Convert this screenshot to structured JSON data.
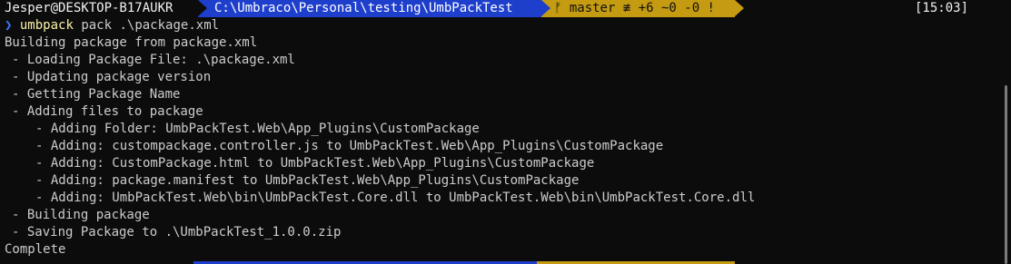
{
  "prompt": {
    "user_host": "Jesper@DESKTOP-B17AUKR",
    "path": "C:\\Umbraco\\Personal\\testing\\UmbPackTest",
    "git_icon": "",
    "git_status": "master ≢ +6 ~0 -0 !",
    "time": "[15:03]",
    "colors": {
      "path_bg": "#1e3fcc",
      "git_bg": "#c59b12",
      "chevron": "#3b78ff",
      "command": "#f9f1a5"
    }
  },
  "command": {
    "chevron": "❯",
    "name": "umbpack",
    "args": "pack .\\package.xml"
  },
  "output": [
    {
      "text": "Building package from package.xml",
      "level": 0
    },
    {
      "text": "- Loading Package File: .\\package.xml",
      "level": 1
    },
    {
      "text": "- Updating package version",
      "level": 1
    },
    {
      "text": "- Getting Package Name",
      "level": 1
    },
    {
      "text": "- Adding files to package",
      "level": 1
    },
    {
      "text": "- Adding Folder: UmbPackTest.Web\\App_Plugins\\CustomPackage",
      "level": 2
    },
    {
      "text": "- Adding: custompackage.controller.js to UmbPackTest.Web\\App_Plugins\\CustomPackage",
      "level": 2
    },
    {
      "text": "- Adding: CustomPackage.html to UmbPackTest.Web\\App_Plugins\\CustomPackage",
      "level": 2
    },
    {
      "text": "- Adding: package.manifest to UmbPackTest.Web\\App_Plugins\\CustomPackage",
      "level": 2
    },
    {
      "text": "- Adding: UmbPackTest.Web\\bin\\UmbPackTest.Core.dll to UmbPackTest.Web\\bin\\UmbPackTest.Core.dll",
      "level": 2
    },
    {
      "text": "- Building package",
      "level": 1
    },
    {
      "text": "- Saving Package to .\\UmbPackTest_1.0.0.zip",
      "level": 1
    },
    {
      "text": "Complete",
      "level": 0
    }
  ]
}
